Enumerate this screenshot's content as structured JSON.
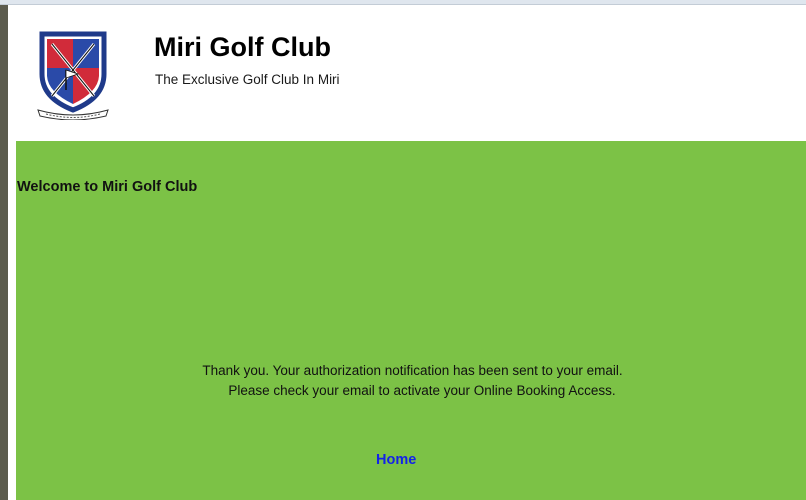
{
  "header": {
    "title": "Miri Golf Club",
    "tagline": "The Exclusive Golf Club In Miri",
    "logo_icon": "golf-club-crest-icon"
  },
  "main": {
    "welcome": "Welcome to Miri Golf Club",
    "message_line1": "Thank you. Your authorization notification has been sent to your email.",
    "message_line2": "Please check your email to activate your Online Booking Access.",
    "home_link": "Home"
  },
  "colors": {
    "content_background": "#7cc246",
    "link": "#1322e8",
    "crest_blue": "#1f3a8a",
    "crest_red": "#d12b3a"
  }
}
